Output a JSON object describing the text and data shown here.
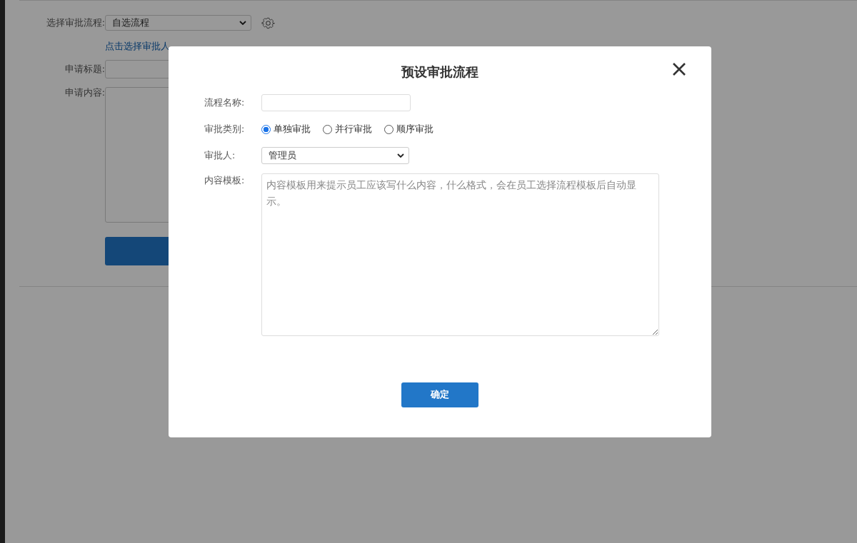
{
  "background_form": {
    "process_label": "选择审批流程:",
    "process_value": "自选流程",
    "approver_link": "点击选择审批人",
    "title_label": "申请标题:",
    "content_label": "申请内容:"
  },
  "dialog": {
    "title": "预设审批流程",
    "name_label": "流程名称:",
    "type_label": "审批类别:",
    "type_options": [
      {
        "label": "单独审批",
        "selected": true
      },
      {
        "label": "并行审批",
        "selected": false
      },
      {
        "label": "顺序审批",
        "selected": false
      }
    ],
    "approver_label": "审批人:",
    "approver_value": "管理员",
    "template_label": "内容模板:",
    "template_placeholder": "内容模板用来提示员工应该写什么内容，什么格式，会在员工选择流程模板后自动显示。",
    "confirm_button": "确定"
  }
}
